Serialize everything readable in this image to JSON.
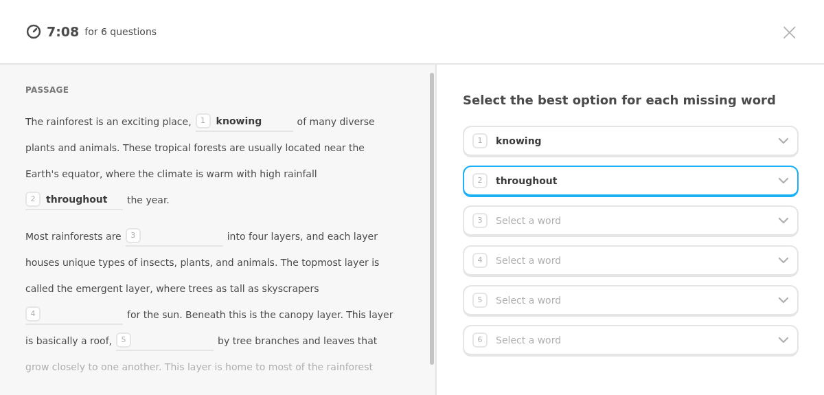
{
  "header": {
    "time": "7:08",
    "suffix": "for 6 questions",
    "close": "×"
  },
  "passage": {
    "label": "PASSAGE",
    "paragraphs": [
      [
        {
          "faded": false,
          "segments": [
            {
              "kind": "text",
              "text": "The rainforest is an exciting place,"
            },
            {
              "kind": "blank",
              "number": "1",
              "word": "knowing"
            },
            {
              "kind": "text",
              "text": "of many diverse"
            }
          ]
        },
        {
          "faded": false,
          "segments": [
            {
              "kind": "text",
              "text": "plants and animals. These tropical forests are usually located near the"
            }
          ]
        },
        {
          "faded": false,
          "segments": [
            {
              "kind": "text",
              "text": "Earth's equator, where the climate is warm with high rainfall"
            }
          ]
        },
        {
          "faded": false,
          "segments": [
            {
              "kind": "blank",
              "number": "2",
              "word": "throughout"
            },
            {
              "kind": "text",
              "text": "the year."
            }
          ]
        }
      ],
      [
        {
          "faded": false,
          "segments": [
            {
              "kind": "text",
              "text": "Most rainforests are"
            },
            {
              "kind": "blank",
              "number": "3"
            },
            {
              "kind": "text",
              "text": "into four layers, and each layer"
            }
          ]
        },
        {
          "faded": false,
          "segments": [
            {
              "kind": "text",
              "text": "houses unique types of insects, plants, and animals. The topmost layer is"
            }
          ]
        },
        {
          "faded": false,
          "segments": [
            {
              "kind": "text",
              "text": "called the emergent layer, where trees as tall as skyscrapers"
            }
          ]
        },
        {
          "faded": false,
          "segments": [
            {
              "kind": "blank",
              "number": "4"
            },
            {
              "kind": "text",
              "text": "for the sun. Beneath this is the canopy layer. This layer"
            }
          ]
        },
        {
          "faded": false,
          "segments": [
            {
              "kind": "text",
              "text": "is basically a roof,"
            },
            {
              "kind": "blank",
              "number": "5"
            },
            {
              "kind": "text",
              "text": "by tree branches and leaves that"
            }
          ]
        },
        {
          "faded": true,
          "segments": [
            {
              "kind": "text",
              "text": "grow closely to one another. This layer is home to most of the rainforest"
            }
          ]
        }
      ]
    ]
  },
  "answers": {
    "title": "Select the best option for each missing word",
    "selects": [
      {
        "number": "1",
        "value": "knowing",
        "selected": false
      },
      {
        "number": "2",
        "value": "throughout",
        "selected": true
      },
      {
        "number": "3",
        "placeholder": "Select a word",
        "selected": false
      },
      {
        "number": "4",
        "placeholder": "Select a word",
        "selected": false
      },
      {
        "number": "5",
        "placeholder": "Select a word",
        "selected": false
      },
      {
        "number": "6",
        "placeholder": "Select a word",
        "selected": false
      }
    ]
  }
}
